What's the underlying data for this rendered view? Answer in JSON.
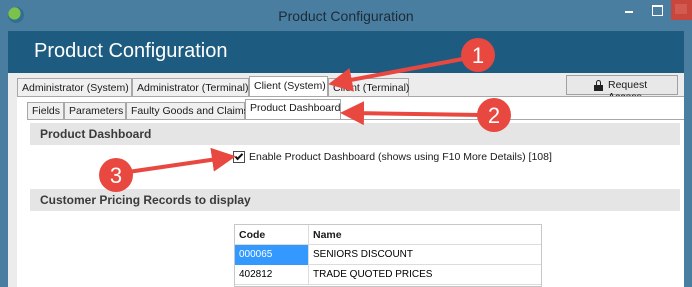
{
  "window": {
    "title": "Product Configuration"
  },
  "header": {
    "title": "Product Configuration"
  },
  "tabs_main": [
    {
      "label": "Administrator (System)",
      "active": false
    },
    {
      "label": "Administrator (Terminal)",
      "active": false
    },
    {
      "label": "Client (System)",
      "active": true
    },
    {
      "label": "Client (Terminal)",
      "active": false
    }
  ],
  "request_access": {
    "label": "Request Access",
    "icon": "lock-icon"
  },
  "tabs_sub": [
    {
      "label": "Fields",
      "active": false
    },
    {
      "label": "Parameters",
      "active": false
    },
    {
      "label": "Faulty Goods and Claims",
      "active": false
    },
    {
      "label": "Product Dashboard",
      "active": true
    }
  ],
  "product_dashboard": {
    "section_title": "Product Dashboard",
    "checkbox_label": "Enable Product Dashboard (shows using F10 More Details) [108]",
    "checked": true
  },
  "pricing": {
    "section_title": "Customer Pricing Records to display",
    "columns": [
      "Code",
      "Name"
    ],
    "rows": [
      {
        "code": "000065",
        "name": "SENIORS DISCOUNT",
        "selected": true
      },
      {
        "code": "402812",
        "name": "TRADE QUOTED PRICES",
        "selected": false
      }
    ]
  },
  "annotations": {
    "color": "#e8483f",
    "markers": [
      "1",
      "2",
      "3"
    ]
  }
}
